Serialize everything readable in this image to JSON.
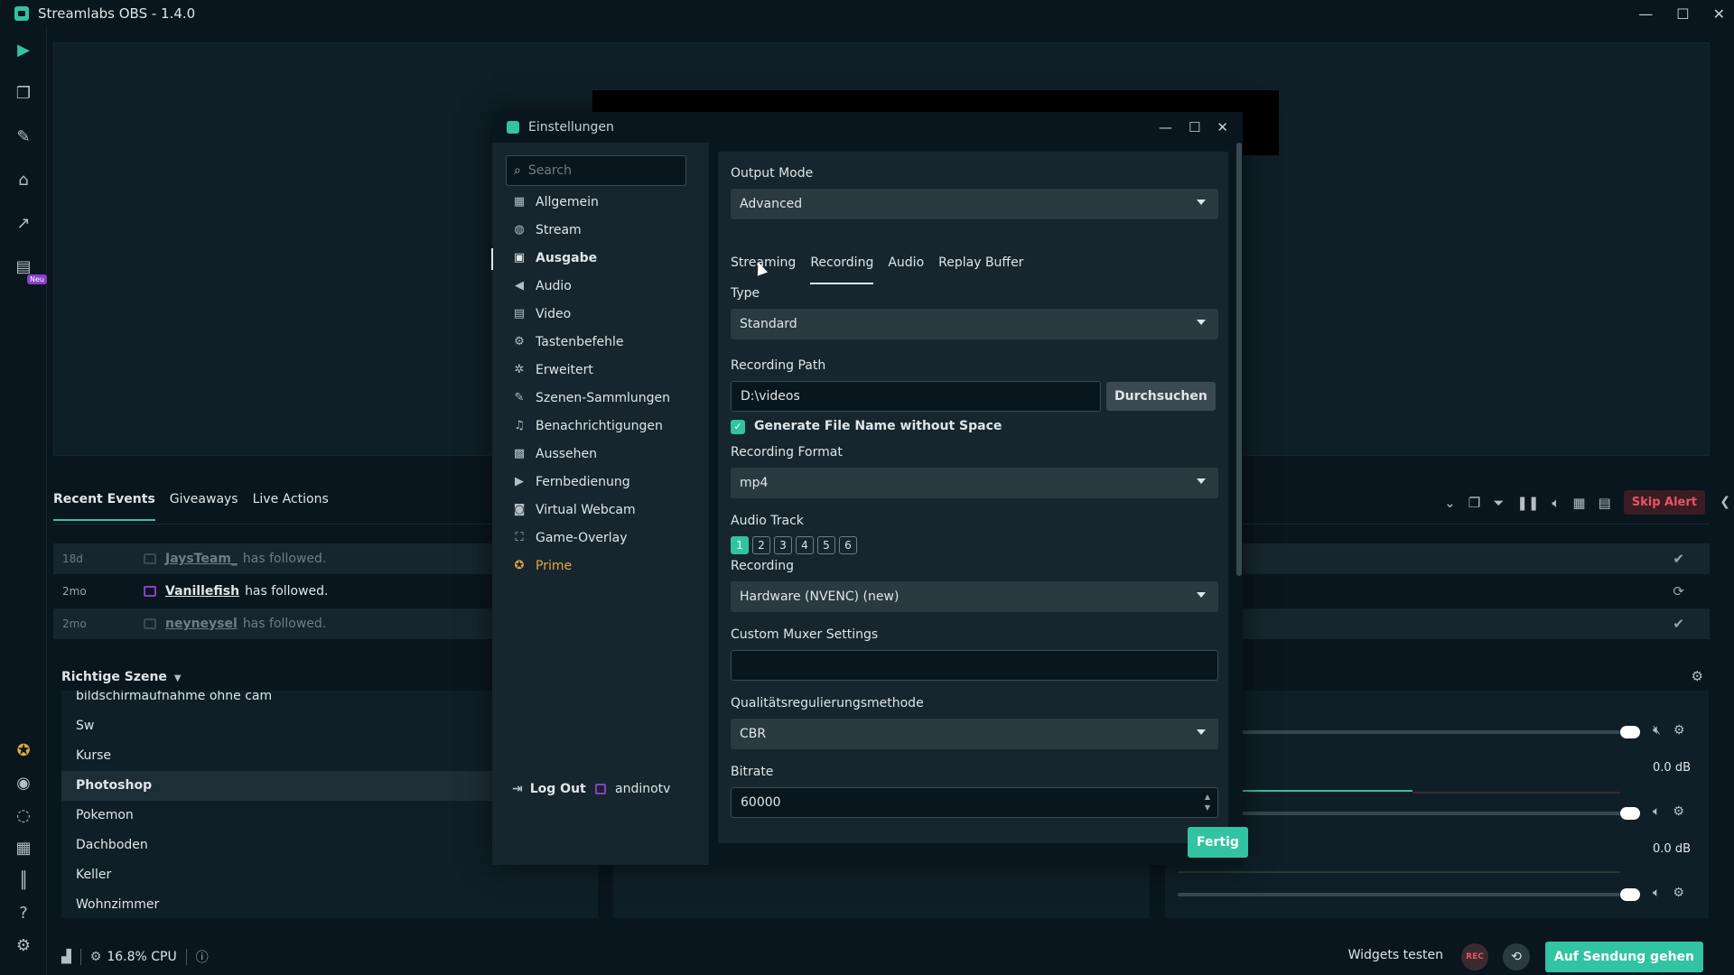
{
  "app": {
    "title": "Streamlabs OBS - 1.4.0"
  },
  "nav": {
    "neu_badge": "Neu"
  },
  "events": {
    "tabs": [
      "Recent Events",
      "Giveaways",
      "Live Actions"
    ],
    "skip_alert": "Skip Alert",
    "rows": [
      {
        "time": "18d",
        "name": "JaysTeam_",
        "action": "has followed.",
        "faded": true
      },
      {
        "time": "2mo",
        "name": "Vanillefish",
        "action": "has followed.",
        "faded": false
      },
      {
        "time": "2mo",
        "name": "neyneysel",
        "action": "has followed.",
        "faded": true
      }
    ]
  },
  "scenes": {
    "header": "Richtige Szene",
    "items": [
      "bildschirmaufnahme ohne cam",
      "Sw",
      "Kurse",
      "Photoshop",
      "Pokemon",
      "Dachboden",
      "Keller",
      "Wohnzimmer"
    ],
    "active": "Photoshop"
  },
  "mixer": {
    "db1": "0.0 dB",
    "db2": "0.0 dB"
  },
  "bottom": {
    "cpu": "16.8% CPU",
    "widgets_test": "Widgets testen",
    "rec": "REC",
    "go_live": "Auf Sendung gehen"
  },
  "dialog": {
    "title": "Einstellungen",
    "search_placeholder": "Search",
    "sidebar": [
      {
        "label": "Allgemein",
        "icon": "grid-icon"
      },
      {
        "label": "Stream",
        "icon": "globe-icon"
      },
      {
        "label": "Ausgabe",
        "icon": "database-icon"
      },
      {
        "label": "Audio",
        "icon": "speaker-icon"
      },
      {
        "label": "Video",
        "icon": "film-icon"
      },
      {
        "label": "Tastenbefehle",
        "icon": "gear-icon"
      },
      {
        "label": "Erweitert",
        "icon": "gears-icon"
      },
      {
        "label": "Szenen-Sammlungen",
        "icon": "paint-icon"
      },
      {
        "label": "Benachrichtigungen",
        "icon": "bell-icon"
      },
      {
        "label": "Aussehen",
        "icon": "apps-icon"
      },
      {
        "label": "Fernbedienung",
        "icon": "play-icon"
      },
      {
        "label": "Virtual Webcam",
        "icon": "camera-icon"
      },
      {
        "label": "Game-Overlay",
        "icon": "overlay-icon"
      },
      {
        "label": "Prime",
        "icon": "prime-icon"
      }
    ],
    "active_item": "Ausgabe",
    "logout": "Log Out",
    "user": "andinotv",
    "output_mode_label": "Output Mode",
    "output_mode_value": "Advanced",
    "sub_tabs": [
      "Streaming",
      "Recording",
      "Audio",
      "Replay Buffer"
    ],
    "active_sub_tab": "Recording",
    "type_label": "Type",
    "type_value": "Standard",
    "path_label": "Recording Path",
    "path_value": "D:\\videos",
    "browse": "Durchsuchen",
    "gen_filename": "Generate File Name without Space",
    "format_label": "Recording Format",
    "format_value": "mp4",
    "audio_track_label": "Audio Track",
    "audio_tracks": [
      "1",
      "2",
      "3",
      "4",
      "5",
      "6"
    ],
    "encoder_label": "Recording",
    "encoder_value": "Hardware (NVENC) (new)",
    "muxer_label": "Custom Muxer Settings",
    "muxer_value": "",
    "rate_control_label": "Qualitätsregulierungsmethode",
    "rate_control_value": "CBR",
    "bitrate_label": "Bitrate",
    "bitrate_value": "60000",
    "done": "Fertig"
  },
  "colors": {
    "accent": "#31c3a2",
    "bg": "#09161d",
    "panel": "#17262e",
    "danger": "#e5556a",
    "prime": "#e6a93c",
    "twitch": "#8a3ec9"
  }
}
